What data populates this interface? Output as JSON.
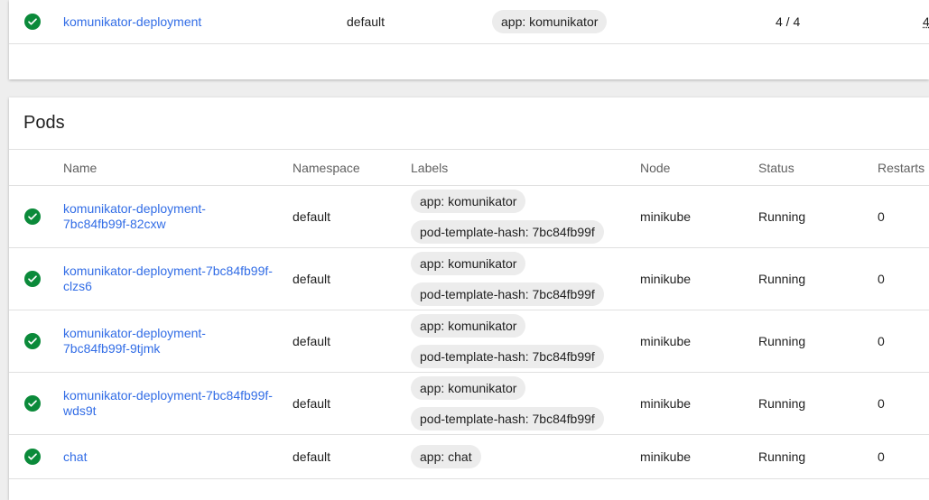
{
  "deployment_row": {
    "name": "komunikator-deployment",
    "namespace": "default",
    "label": "app: komunikator",
    "pods": "4 / 4",
    "created_partial": "4"
  },
  "pods": {
    "title": "Pods",
    "columns": {
      "name": "Name",
      "namespace": "Namespace",
      "labels": "Labels",
      "node": "Node",
      "status": "Status",
      "restarts": "Restarts"
    },
    "rows": [
      {
        "name_line1": "komunikator-deployment-",
        "name_line2": "7bc84fb99f-82cxw",
        "namespace": "default",
        "labels": [
          "app: komunikator",
          "pod-template-hash: 7bc84fb99f"
        ],
        "node": "minikube",
        "status": "Running",
        "restarts": "0"
      },
      {
        "name_line1": "komunikator-deployment-7bc84fb99f-",
        "name_line2": "clzs6",
        "namespace": "default",
        "labels": [
          "app: komunikator",
          "pod-template-hash: 7bc84fb99f"
        ],
        "node": "minikube",
        "status": "Running",
        "restarts": "0"
      },
      {
        "name_line1": "komunikator-deployment-",
        "name_line2": "7bc84fb99f-9tjmk",
        "namespace": "default",
        "labels": [
          "app: komunikator",
          "pod-template-hash: 7bc84fb99f"
        ],
        "node": "minikube",
        "status": "Running",
        "restarts": "0"
      },
      {
        "name_line1": "komunikator-deployment-7bc84fb99f-",
        "name_line2": "wds9t",
        "namespace": "default",
        "labels": [
          "app: komunikator",
          "pod-template-hash: 7bc84fb99f"
        ],
        "node": "minikube",
        "status": "Running",
        "restarts": "0"
      },
      {
        "name_line1": "chat",
        "name_line2": "",
        "namespace": "default",
        "labels": [
          "app: chat"
        ],
        "node": "minikube",
        "status": "Running",
        "restarts": "0"
      }
    ]
  },
  "icons": {
    "status": "check-circle-icon"
  },
  "colors": {
    "success": "#0b8a3a",
    "link": "#326de6",
    "chip": "#ececec"
  }
}
